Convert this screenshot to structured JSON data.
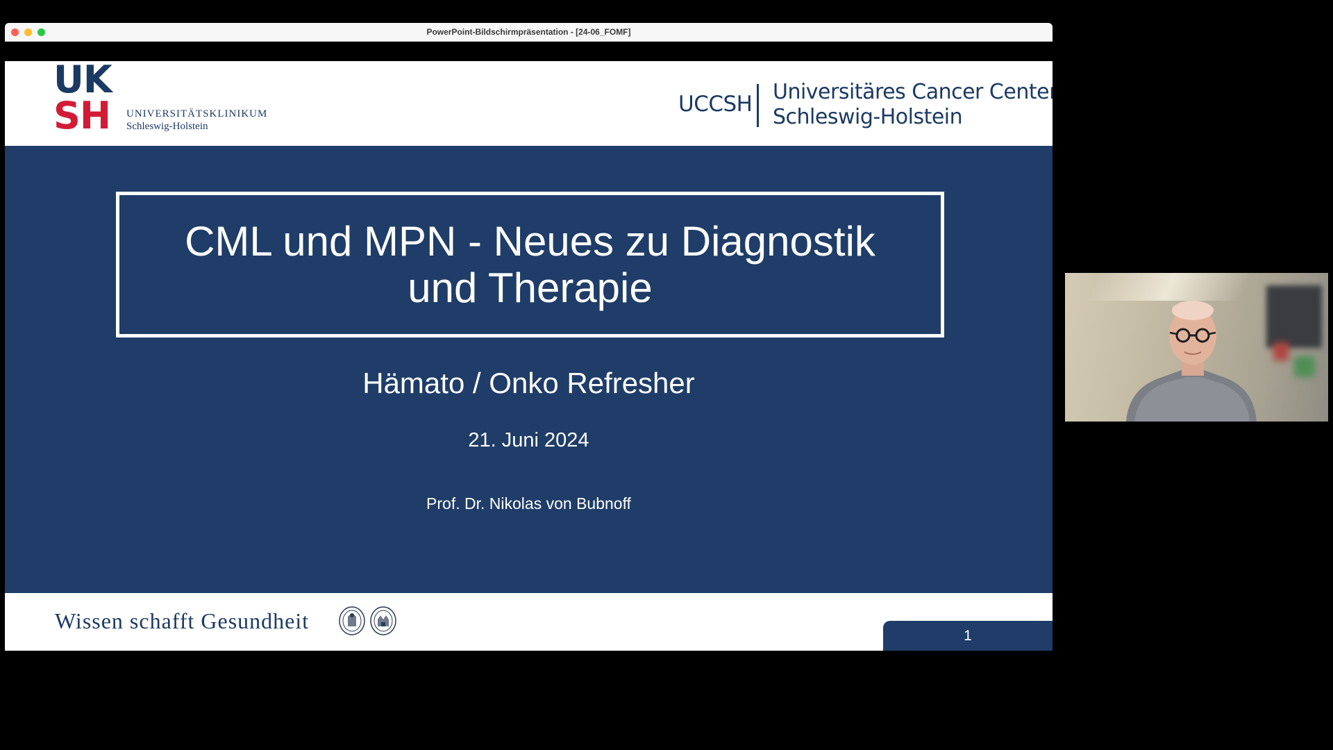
{
  "window": {
    "title": "PowerPoint-Bildschirmpräsentation - [24-06_FOMF]"
  },
  "header": {
    "uksh_logo_line1": "UK",
    "uksh_logo_line2": "SH",
    "uksh_name": "UNIVERSITÄTSKLINIKUM",
    "uksh_location": "Schleswig-Holstein",
    "uccsh_abbr": "UCCSH",
    "uccsh_name_line1": "Universitäres Cancer Center",
    "uccsh_name_line2": "Schleswig-Holstein"
  },
  "slide": {
    "title_line1": "CML und MPN - Neues zu Diagnostik",
    "title_line2": "und Therapie",
    "subtitle": "Hämato / Onko Refresher",
    "date": "21. Juni 2024",
    "author": "Prof. Dr. Nikolas von Bubnoff",
    "number": "1"
  },
  "footer": {
    "slogan": "Wissen schafft Gesundheit"
  },
  "colors": {
    "navy": "#1f3d68",
    "logo_blue": "#1b3a63",
    "logo_red": "#d21c36"
  },
  "icons": {
    "seal_left": "university-seal-icon",
    "seal_right": "university-seal-icon"
  }
}
